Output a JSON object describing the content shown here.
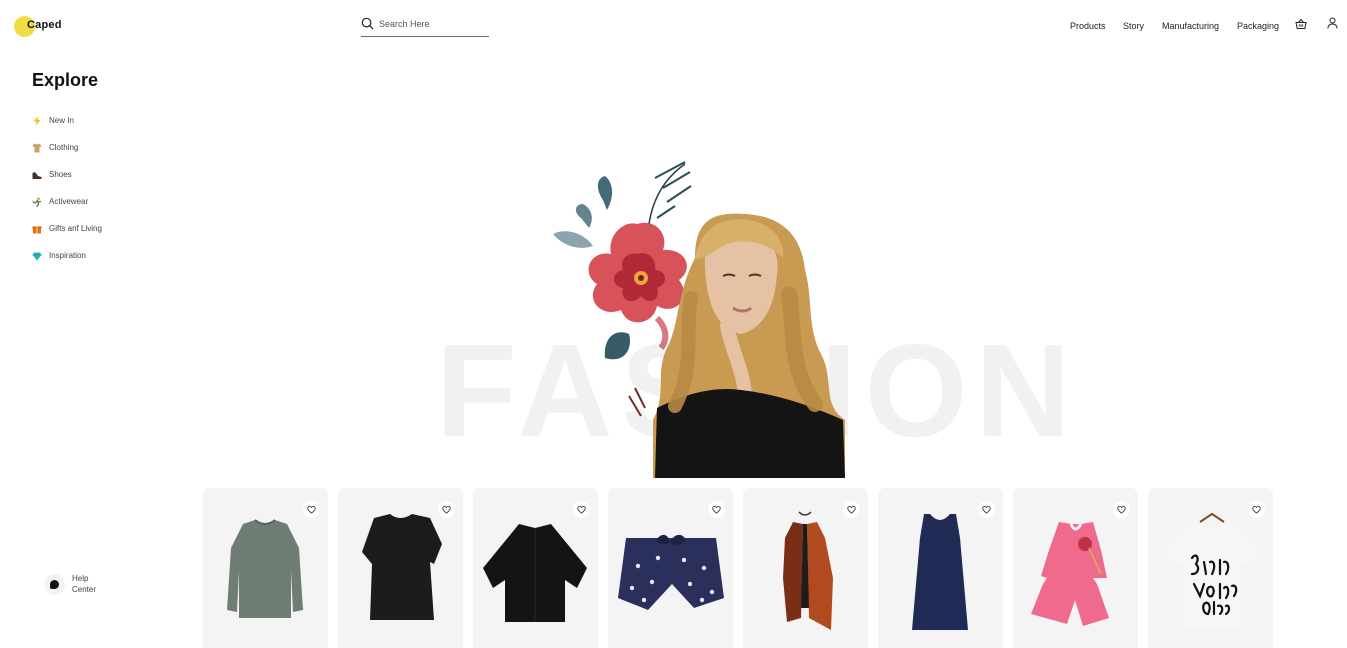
{
  "brand": {
    "name": "Caped",
    "accent": "#f2dc45"
  },
  "search": {
    "placeholder": "Search Here",
    "icon": "search-icon"
  },
  "nav": {
    "items": [
      "Products",
      "Story",
      "Manufacturing",
      "Packaging"
    ],
    "basket_icon": "basket-icon",
    "user_icon": "user-icon"
  },
  "sidebar": {
    "title": "Explore",
    "categories": [
      {
        "label": "New In",
        "icon": "lightning-icon"
      },
      {
        "label": "Clothing",
        "icon": "clothing-icon"
      },
      {
        "label": "Shoes",
        "icon": "shoe-icon"
      },
      {
        "label": "Activewear",
        "icon": "activewear-icon"
      },
      {
        "label": "Gifts anf Living",
        "icon": "gift-icon"
      },
      {
        "label": "Inspiration",
        "icon": "gem-icon"
      }
    ],
    "help": {
      "label_line1": "Help",
      "label_line2": "Center"
    }
  },
  "hero": {
    "word": "FASHION"
  },
  "products": [
    {
      "name": "sweater",
      "color": "#6f7d75"
    },
    {
      "name": "black-top",
      "color": "#1c1c1c"
    },
    {
      "name": "kimono",
      "color": "#141414"
    },
    {
      "name": "shorts",
      "color": "#2a2f5c"
    },
    {
      "name": "vest",
      "color": "#8a3a1a"
    },
    {
      "name": "dress",
      "color": "#1f2a55"
    },
    {
      "name": "pink-set",
      "color": "#f06a8e"
    },
    {
      "name": "tshirt",
      "color": "#f7f7f7"
    }
  ]
}
